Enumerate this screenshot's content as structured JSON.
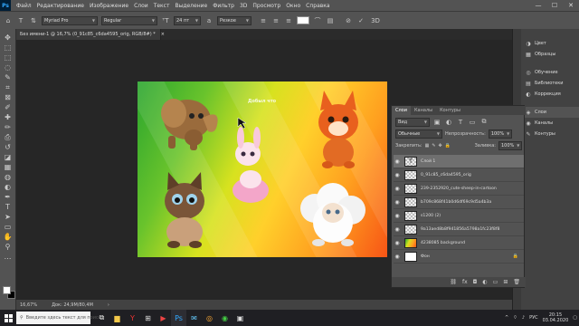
{
  "app": {
    "logo": "Ps"
  },
  "menu": [
    "Файл",
    "Редактирование",
    "Изображение",
    "Слои",
    "Текст",
    "Выделение",
    "Фильтр",
    "3D",
    "Просмотр",
    "Окно",
    "Справка"
  ],
  "window_controls": {
    "minimize": "—",
    "maximize": "☐",
    "close": "✕"
  },
  "options": {
    "font_family": "Myriad Pro",
    "font_style": "Regular",
    "font_size": "24 пт",
    "antialias": "Резкое",
    "cancel_icon": "⊘",
    "commit_icon": "✓",
    "threed": "3D"
  },
  "document": {
    "tab_title": "Без имени-1 @ 16,7% (0_91c85_c6da4595_orig, RGB/8#) *",
    "close": "×",
    "watermark": "Добыл что",
    "zoom": "16,67%",
    "doc_info": "Док: 24,9M/80,4M"
  },
  "tools": [
    "move-tool",
    "artboard-tool",
    "marquee-tool",
    "lasso-tool",
    "quick-select-tool",
    "crop-tool",
    "frame-tool",
    "eyedropper-tool",
    "healing-tool",
    "brush-tool",
    "stamp-tool",
    "history-brush-tool",
    "eraser-tool",
    "gradient-tool",
    "blur-tool",
    "dodge-tool",
    "pen-tool",
    "type-tool",
    "path-select-tool",
    "shape-tool",
    "hand-tool",
    "zoom-tool",
    "more-tools"
  ],
  "tool_glyphs": [
    "✥",
    "⬚",
    "⬚",
    "◌",
    "✎",
    "⌗",
    "⊠",
    "✐",
    "✚",
    "✏",
    "⎙",
    "↺",
    "◪",
    "▦",
    "◍",
    "◐",
    "✒",
    "T",
    "➤",
    "▭",
    "✋",
    "⚲",
    "…"
  ],
  "right_panel": {
    "items": [
      {
        "label": "Цвет",
        "icon": "color-wheel-icon",
        "glyph": "◑"
      },
      {
        "label": "Образцы",
        "icon": "swatches-icon",
        "glyph": "▦"
      },
      {
        "label": "Обучение",
        "icon": "learn-icon",
        "glyph": "◎"
      },
      {
        "label": "Библиотеки",
        "icon": "libraries-icon",
        "glyph": "▤"
      },
      {
        "label": "Коррекция",
        "icon": "adjustments-icon",
        "glyph": "◐"
      },
      {
        "label": "Слои",
        "icon": "layers-icon",
        "glyph": "◈"
      },
      {
        "label": "Каналы",
        "icon": "channels-icon",
        "glyph": "◉"
      },
      {
        "label": "Контуры",
        "icon": "paths-icon",
        "glyph": "✎"
      }
    ]
  },
  "layers_panel": {
    "tabs": [
      "Слои",
      "Каналы",
      "Контуры"
    ],
    "filter_placeholder": "Вид",
    "blend_mode": "Обычные",
    "opacity_label": "Непрозрачность:",
    "opacity_value": "100%",
    "lock_label": "Закрепить:",
    "fill_label": "Заливка:",
    "fill_value": "100%",
    "layers": [
      {
        "name": "Слой 1",
        "thumb": "T",
        "selected": true
      },
      {
        "name": "0_91c85_c6da4595_orig",
        "thumb": "",
        "selected": false
      },
      {
        "name": "239-2352920_cute-sheep-in-cartoon",
        "thumb": "",
        "selected": false
      },
      {
        "name": "b709c868f41b0d6df69c9d5a4b3a",
        "thumb": "",
        "selected": false
      },
      {
        "name": "s1200 (2)",
        "thumb": "",
        "selected": false
      },
      {
        "name": "9a13aed8b8f941856a5798a1fc23f8f8",
        "thumb": "",
        "selected": false
      },
      {
        "name": "4238085 background",
        "thumb": "",
        "selected": false
      },
      {
        "name": "Фон",
        "thumb": "",
        "selected": false,
        "locked": true
      }
    ]
  },
  "taskbar": {
    "search_placeholder": "Введите здесь текст для поиска",
    "apps": [
      "task-view",
      "file-explorer",
      "yandex-browser",
      "store",
      "media",
      "photoshop",
      "mail",
      "browser",
      "chrome",
      "misc"
    ]
  },
  "tray": {
    "lang": "РУС",
    "time": "20:15",
    "date": "03.04.2020"
  }
}
